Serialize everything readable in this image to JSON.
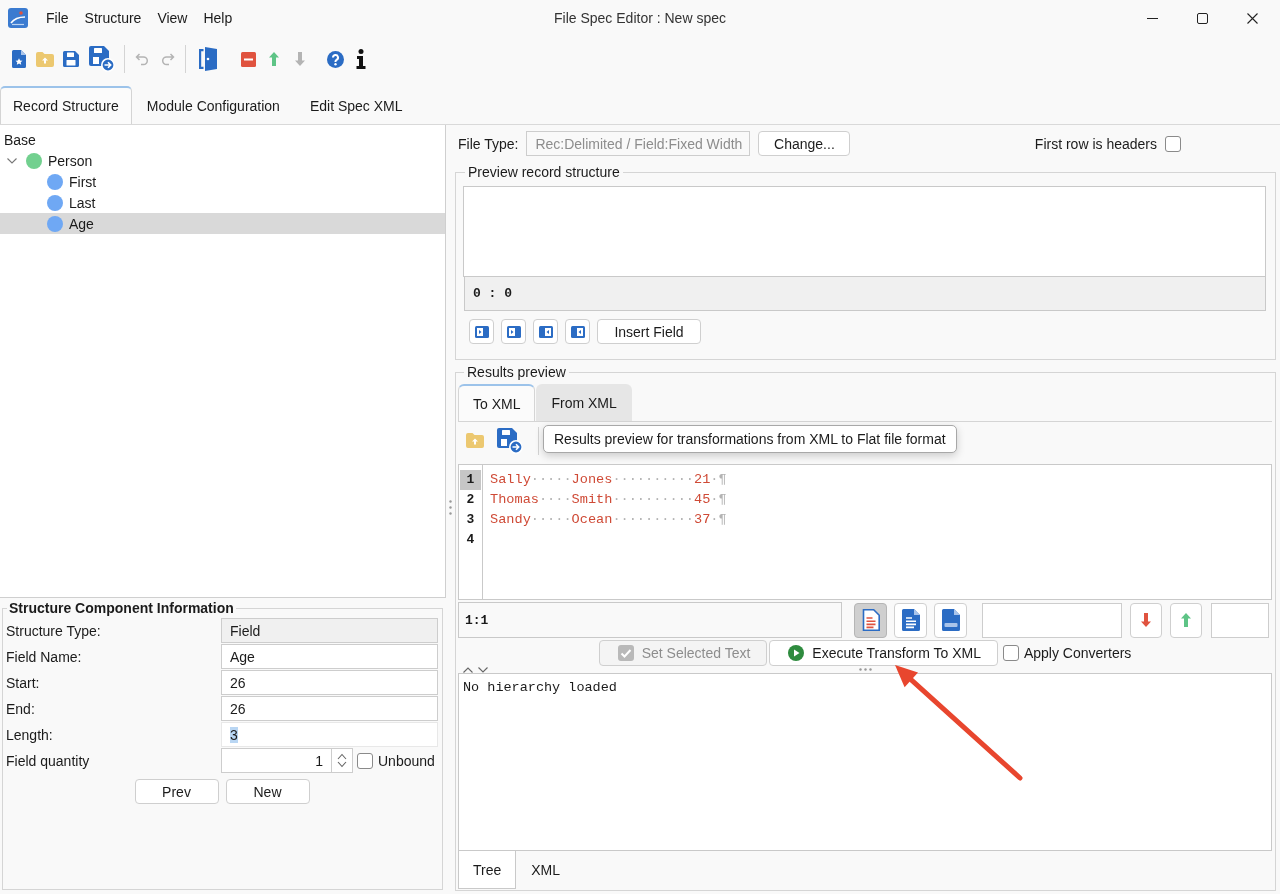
{
  "window": {
    "title": "File Spec Editor : New spec"
  },
  "menu": [
    "File",
    "Structure",
    "View",
    "Help"
  ],
  "toolbar": [
    {
      "kind": "new",
      "disabled": false
    },
    {
      "kind": "open",
      "disabled": false
    },
    {
      "kind": "save",
      "disabled": false
    },
    {
      "kind": "save-as",
      "disabled": false
    },
    {
      "kind": "separator"
    },
    {
      "kind": "undo",
      "disabled": true
    },
    {
      "kind": "redo",
      "disabled": true
    },
    {
      "kind": "separator"
    },
    {
      "kind": "exit",
      "disabled": false
    },
    {
      "kind": "delete",
      "disabled": false
    },
    {
      "kind": "move-up",
      "disabled": false
    },
    {
      "kind": "move-down",
      "disabled": true
    },
    {
      "kind": "help",
      "disabled": false
    },
    {
      "kind": "info",
      "disabled": false
    }
  ],
  "tabs": [
    {
      "label": "Record Structure",
      "selected": true
    },
    {
      "label": "Module Configuration",
      "selected": false
    },
    {
      "label": "Edit Spec XML",
      "selected": false
    }
  ],
  "tree": [
    {
      "label": "Base",
      "kind": "root",
      "selected": false,
      "children": [
        {
          "label": "Person",
          "kind": "record",
          "expanded": true,
          "selected": false,
          "children": [
            {
              "label": "First",
              "kind": "field",
              "selected": false
            },
            {
              "label": "Last",
              "kind": "field",
              "selected": false
            },
            {
              "label": "Age",
              "kind": "field",
              "selected": true
            }
          ]
        }
      ]
    }
  ],
  "component_info": {
    "title": "Structure Component Information",
    "fields": [
      {
        "label": "Structure Type:",
        "kind": "readonly",
        "value": "Field",
        "text_selected": false
      },
      {
        "label": "Field Name:",
        "kind": "text",
        "value": "Age",
        "text_selected": false
      },
      {
        "label": "Start:",
        "kind": "text",
        "value": "26",
        "text_selected": false
      },
      {
        "label": "End:",
        "kind": "text",
        "value": "26",
        "text_selected": false
      },
      {
        "label": "Length:",
        "kind": "text",
        "value": "3",
        "text_selected": true
      },
      {
        "label": "Field quantity",
        "kind": "spinner",
        "value": "1",
        "text_selected": false,
        "checkbox": {
          "label": "Unbound",
          "checked": false
        }
      }
    ],
    "buttons": [
      "Prev",
      "New"
    ]
  },
  "file_type": {
    "label": "File Type:",
    "value": "Rec:Delimited / Field:Fixed Width",
    "disabled": true,
    "button": "Change..."
  },
  "first_row_is_headers": {
    "label": "First row is headers",
    "checked": false
  },
  "preview_record_structure": {
    "title": "Preview record structure",
    "position": "0 : 0",
    "icon_buttons": [
      {
        "kind": "left"
      },
      {
        "kind": "left"
      },
      {
        "kind": "right"
      },
      {
        "kind": "right"
      }
    ],
    "insert_button": "Insert Field"
  },
  "results_preview": {
    "title": "Results preview",
    "tabs": [
      {
        "label": "To XML",
        "selected": true
      },
      {
        "label": "From XML",
        "selected": false
      }
    ],
    "toolbar": [
      {
        "kind": "open"
      },
      {
        "kind": "save-as"
      }
    ],
    "tooltip": "Results preview for transformations from XML to Flat file format",
    "lines": [
      {
        "number": "1",
        "text": "Sally·····Jones··········21·¶",
        "current": true
      },
      {
        "number": "2",
        "text": "Thomas····Smith··········45·¶",
        "current": false
      },
      {
        "number": "3",
        "text": "Sandy·····Ocean··········37·¶",
        "current": false
      },
      {
        "number": "4",
        "current": false
      }
    ],
    "position": "1:1",
    "view_buttons": [
      {
        "kind": "text-marked",
        "selected": true
      },
      {
        "kind": "text",
        "selected": false
      },
      {
        "kind": "html",
        "selected": false
      }
    ],
    "nav_buttons": [
      {
        "kind": "down"
      },
      {
        "kind": "up"
      }
    ],
    "actions": [
      {
        "label": "Set Selected Text",
        "kind": "set",
        "disabled": true
      },
      {
        "label": "Execute Transform To XML",
        "kind": "execute",
        "disabled": false
      }
    ],
    "apply_converters": {
      "label": "Apply Converters",
      "checked": false
    },
    "output": "No hierarchy loaded",
    "bottom_tabs": [
      {
        "label": "Tree",
        "selected": true
      },
      {
        "label": "XML",
        "selected": false
      }
    ]
  },
  "annotations": [
    {
      "kind": "arrow"
    }
  ]
}
